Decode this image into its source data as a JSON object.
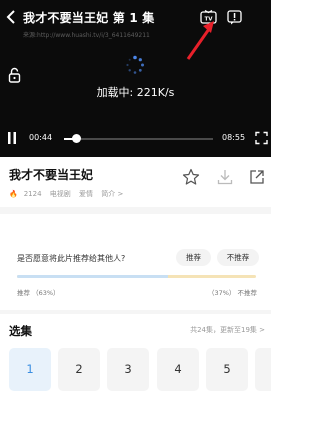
{
  "player": {
    "title": "我才不要当王妃  第 1 集",
    "url": "来源:http://www.huashi.tv/i/3_6411649211",
    "loading_text": "加载中: 221K/s",
    "current_time": "00:44",
    "total_time": "08:55",
    "progress": 0.082,
    "icons": [
      "back-icon",
      "tv-cast-icon",
      "report-icon",
      "lock-icon",
      "loading-spinner-icon",
      "pause-icon",
      "fullscreen-icon"
    ]
  },
  "show": {
    "title": "我才不要当王妃",
    "heat": "2124",
    "tags": [
      "电视剧",
      "爱情",
      "简介 >"
    ],
    "actions": [
      "favorite-icon",
      "download-icon",
      "share-icon"
    ]
  },
  "recommend": {
    "question": "是否愿意将此片推荐给其他人?",
    "yes_label": "推荐",
    "no_label": "不推荐",
    "yes_stat": "推荐  （63%）",
    "no_stat": "（37%） 不推荐",
    "yes_share": 0.63,
    "colors": {
      "yes": "#c8dff3",
      "no": "#f5e3b6"
    }
  },
  "episodes": {
    "title": "选集",
    "summary": "共24集，更新至19集 >",
    "items": [
      "1",
      "2",
      "3",
      "4",
      "5"
    ],
    "active_index": 0,
    "accent": "#3a8ee0"
  }
}
